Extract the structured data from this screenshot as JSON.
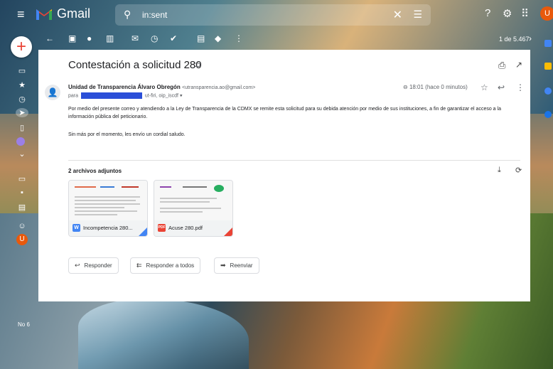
{
  "app": {
    "name": "Gmail"
  },
  "search": {
    "value": "in:sent"
  },
  "header": {
    "avatar_letter": "U"
  },
  "toolbar": {
    "pager": "1 de 5.467"
  },
  "message": {
    "subject": "Contestación a solicitud 280",
    "sender_name": "Unidad de Transparencia Álvaro Obregón",
    "sender_email": "<utransparencia.ao@gmail.com>",
    "to_prefix": "para",
    "to_suffix": "ut-firi, oip_iscdf",
    "time": "18:01 (hace 0 minutos)",
    "body_p1": "Por medio del presente correo y atendiendo a la Ley de Transparencia de la CDMX se remite esta solicitud para su debida atención por medio de sus instituciones, a fin de garantizar el acceso a la información pública del peticionario.",
    "body_p2": "Sin más por el momento, les envío un cordial saludo."
  },
  "attachments": {
    "title": "2 archivos adjuntos",
    "items": [
      {
        "name": "Incompetencia 280...",
        "type_badge": "W",
        "badge_color": "#4285f4"
      },
      {
        "name": "Acuse 280.pdf",
        "type_badge": "PDF",
        "badge_color": "#ea4335"
      }
    ]
  },
  "actions": {
    "reply": "Responder",
    "reply_all": "Responder a todos",
    "forward": "Reenviar"
  },
  "rail": {
    "bottom_label": "No 6"
  },
  "colors": {
    "accent": "#ea4335",
    "redaction": "#2b4fd8",
    "avatar": "#e8590c"
  }
}
